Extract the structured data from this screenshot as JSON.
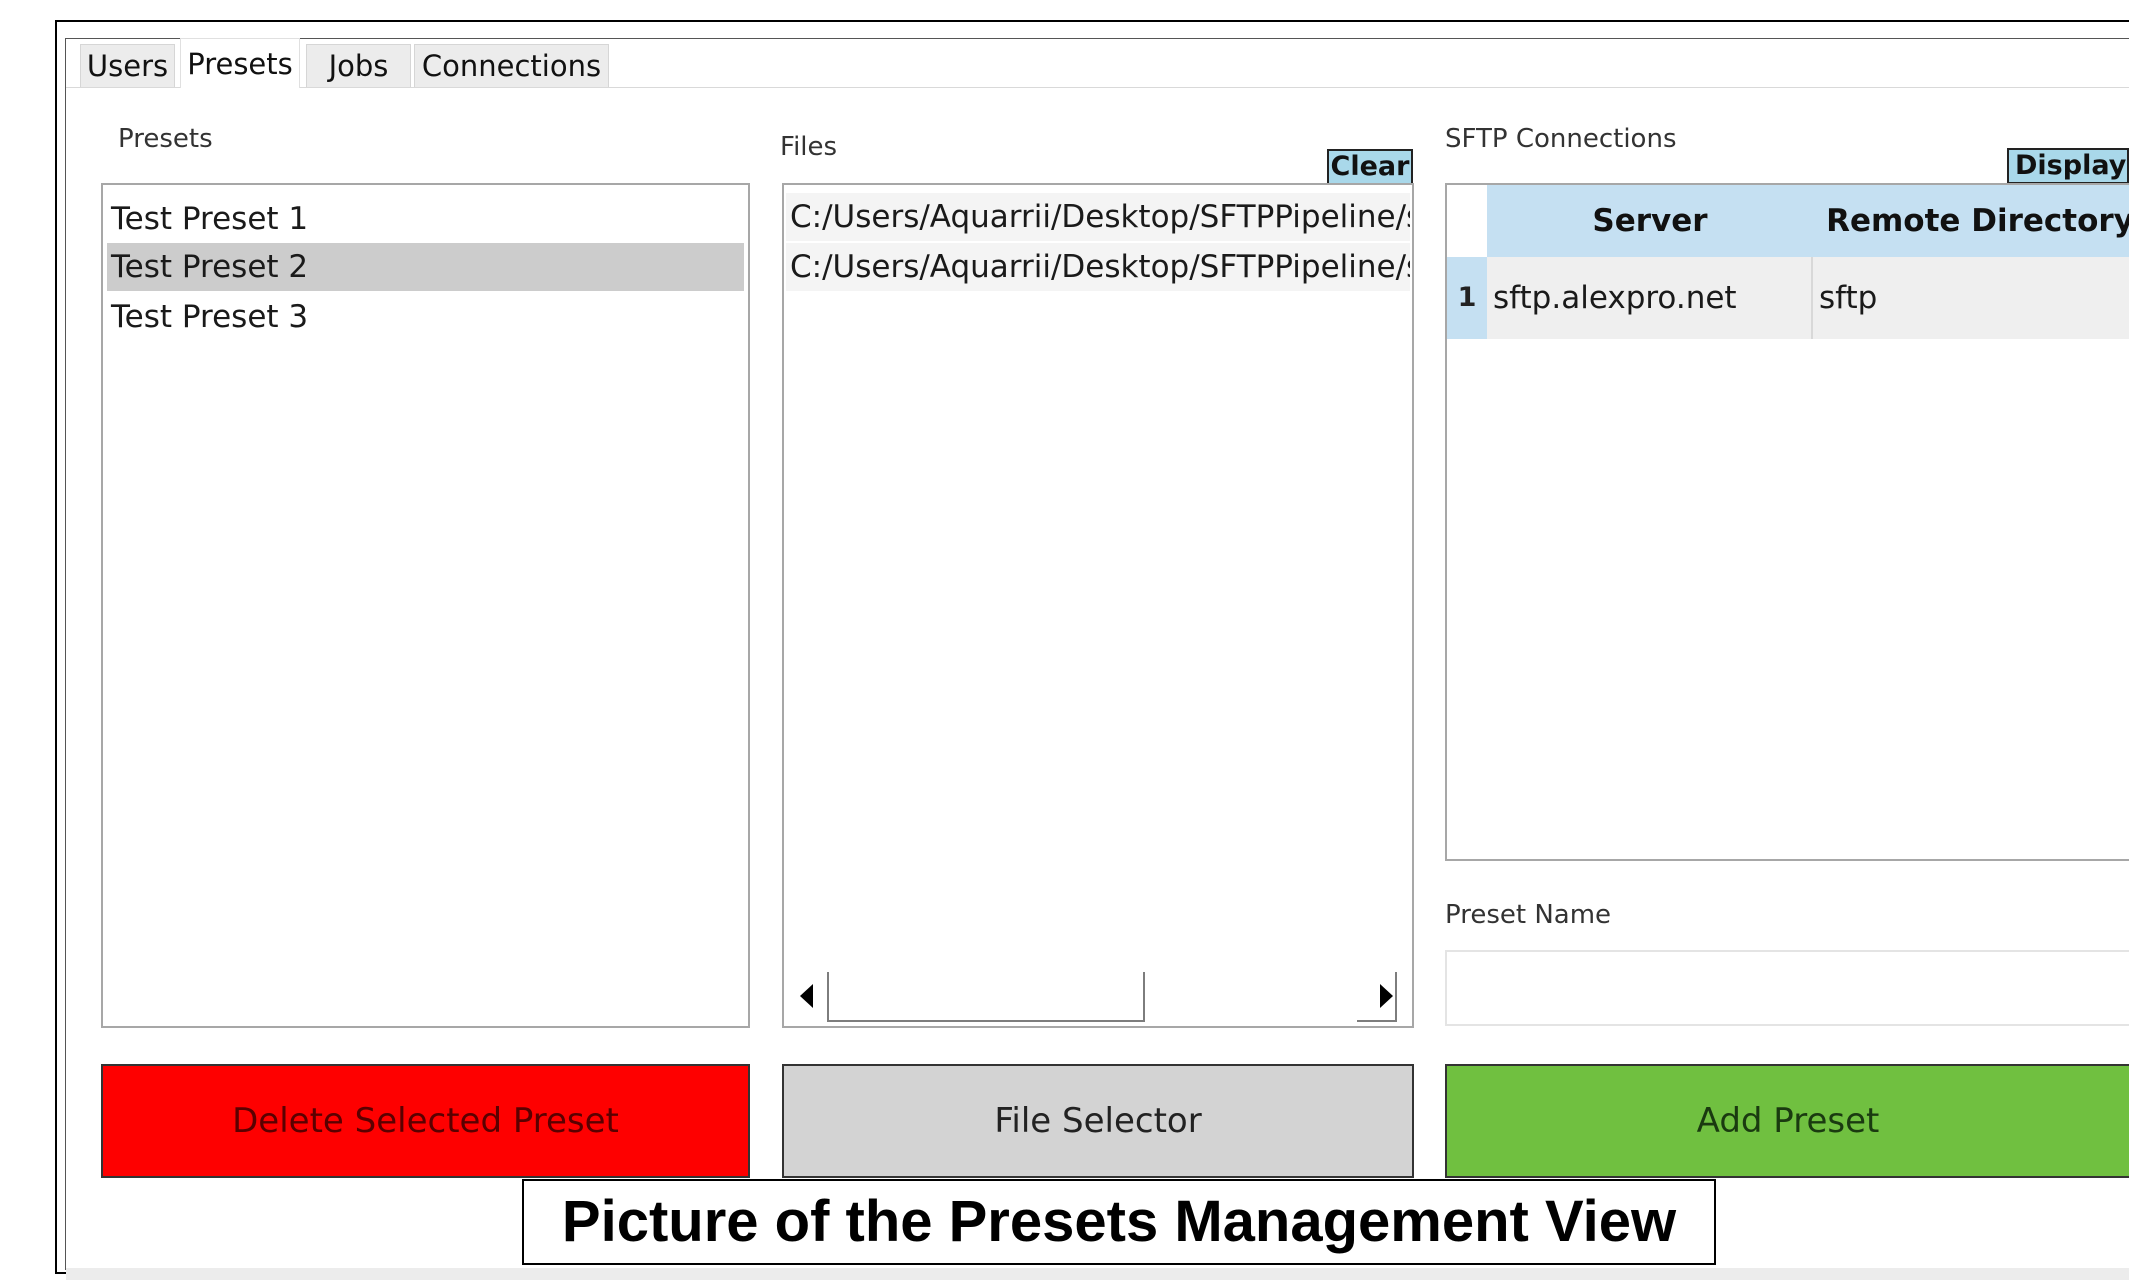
{
  "tabs": [
    "Users",
    "Presets",
    "Jobs",
    "Connections"
  ],
  "active_tab": "Presets",
  "presets": {
    "label": "Presets",
    "items": [
      "Test Preset 1",
      "Test Preset 2",
      "Test Preset 3"
    ],
    "selected": "Test Preset 2"
  },
  "files": {
    "label": "Files",
    "clear_label": "Clear",
    "items": [
      "C:/Users/Aquarrii/Desktop/SFTPPipeline/src/as",
      "C:/Users/Aquarrii/Desktop/SFTPPipeline/src/as"
    ]
  },
  "sftp": {
    "label": "SFTP Connections",
    "display_all_label": "Display A",
    "columns": [
      "Server",
      "Remote Directory"
    ],
    "rows": [
      {
        "index": "1",
        "server": "sftp.alexpro.net",
        "remote_directory": "sftp"
      }
    ]
  },
  "preset_name": {
    "label": "Preset Name",
    "value": ""
  },
  "buttons": {
    "delete": "Delete Selected Preset",
    "file_selector": "File Selector",
    "add": "Add Preset"
  },
  "caption": "Picture of the Presets Management View",
  "colors": {
    "delete_bg": "#fe0000",
    "delete_text": "#5a0000",
    "file_selector_bg": "#d3d3d3",
    "add_bg": "#70c040",
    "header_blue": "#c5e0f2",
    "clear_bg": "#a9d8ea"
  }
}
